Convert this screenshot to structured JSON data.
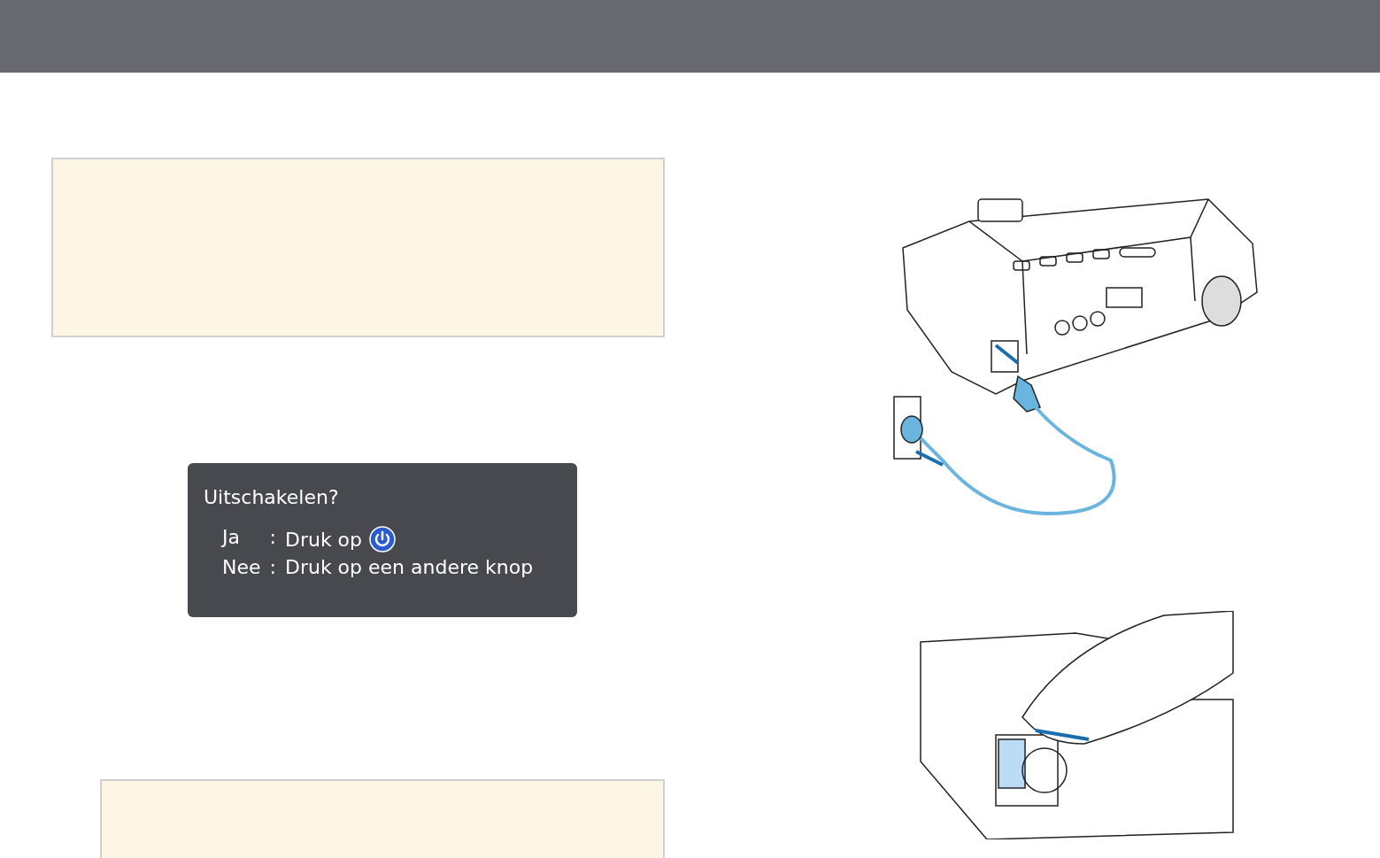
{
  "dialog": {
    "title": "Uitschakelen?",
    "rows": [
      {
        "label": "Ja",
        "separator": ":",
        "action": "Druk op",
        "kind": "power"
      },
      {
        "label": "Nee",
        "separator": ":",
        "action": "Druk op een andere knop",
        "kind": "plain"
      }
    ]
  }
}
